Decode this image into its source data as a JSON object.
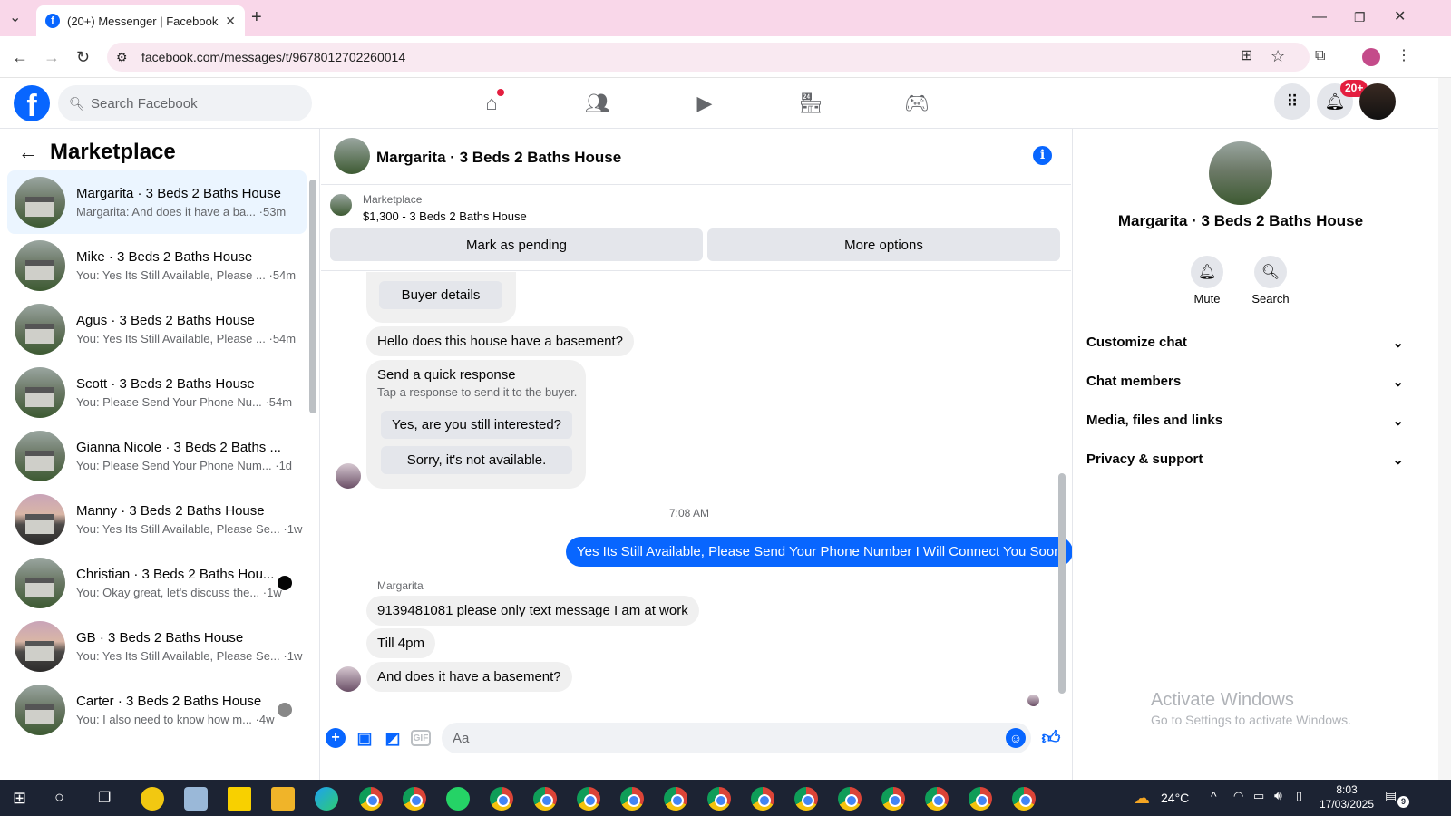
{
  "browser": {
    "tab_title": "(20+) Messenger | Facebook",
    "url": "facebook.com/messages/t/9678012702260014"
  },
  "header": {
    "search_placeholder": "Search Facebook",
    "notif_badge": "20+",
    "brand_color": "#0866ff"
  },
  "sidebar": {
    "title": "Marketplace",
    "conversations": [
      {
        "name": "Margarita · 3 Beds 2 Baths House",
        "snippet": "Margarita: And does it have a ba...",
        "time": "·53m"
      },
      {
        "name": "Mike · 3 Beds 2 Baths House",
        "snippet": "You: Yes Its Still Available, Please ...",
        "time": "·54m"
      },
      {
        "name": "Agus · 3 Beds 2 Baths House",
        "snippet": "You: Yes Its Still Available, Please ...",
        "time": "·54m"
      },
      {
        "name": "Scott · 3 Beds 2 Baths House",
        "snippet": "You: Please Send Your Phone Nu...",
        "time": "·54m"
      },
      {
        "name": "Gianna Nicole · 3 Beds 2 Baths ...",
        "snippet": "You: Please Send Your Phone Num...",
        "time": "·1d"
      },
      {
        "name": "Manny · 3 Beds 2 Baths House",
        "snippet": "You: Yes Its Still Available, Please Se...",
        "time": "·1w"
      },
      {
        "name": "Christian · 3 Beds 2 Baths Hou...",
        "snippet": "You: Okay great, let's discuss the...",
        "time": "·1w"
      },
      {
        "name": "GB · 3 Beds 2 Baths House",
        "snippet": "You: Yes Its Still Available, Please Se...",
        "time": "·1w"
      },
      {
        "name": "Carter · 3 Beds 2 Baths House",
        "snippet": "You: I also need to know how m...",
        "time": "·4w"
      }
    ]
  },
  "chat": {
    "title": "Margarita · 3 Beds 2 Baths House",
    "listing_source": "Marketplace",
    "listing_price": "$1,300 - 3 Beds 2 Baths House",
    "mark_pending": "Mark as pending",
    "more_options": "More options",
    "buyer_details": "Buyer details",
    "msg_basement": "Hello does this house have a basement?",
    "quick_title": "Send a quick response",
    "quick_sub": "Tap a response to send it to the buyer.",
    "quick_yes": "Yes, are you still interested?",
    "quick_no": "Sorry, it's not available.",
    "timestamp": "7:08 AM",
    "my_reply": "Yes Its Still Available, Please Send Your Phone Number I Will Connect You Soon",
    "sender_label": "Margarita",
    "msg_phone": "9139481081 please only text message I am at work",
    "msg_till": "Till 4pm",
    "msg_basement2": "And does it have a basement?",
    "composer_placeholder": "Aa"
  },
  "details": {
    "name": "Margarita · 3 Beds 2 Baths House",
    "mute": "Mute",
    "search": "Search",
    "sections": [
      "Customize chat",
      "Chat members",
      "Media, files and links",
      "Privacy & support"
    ]
  },
  "watermark": {
    "line1": "Activate Windows",
    "line2": "Go to Settings to activate Windows."
  },
  "taskbar": {
    "temp": "24°C",
    "time": "8:03",
    "date": "17/03/2025",
    "notif": "9"
  }
}
